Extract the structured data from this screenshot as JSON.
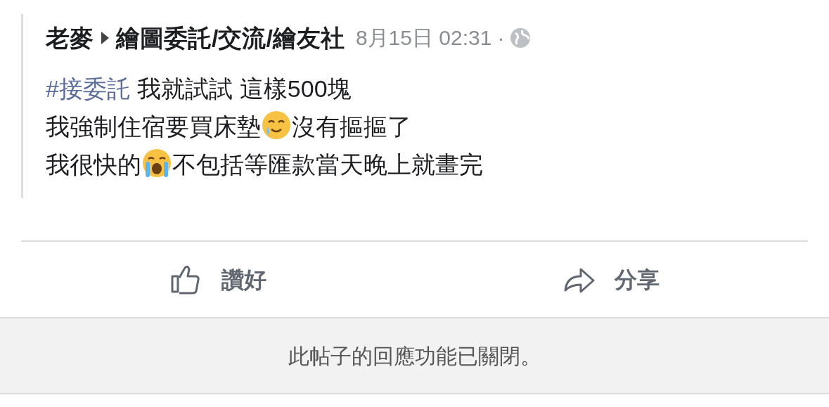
{
  "post": {
    "author": "老麥",
    "group": "繪圖委託/交流/繪友社",
    "time": "8月15日 02:31",
    "separator": "·",
    "lines": [
      [
        {
          "kind": "hashtag",
          "text": "#接委託"
        },
        {
          "kind": "text",
          "text": " 我就試試 這樣500塊"
        }
      ],
      [
        {
          "kind": "text",
          "text": "我強制住宿要買床墊"
        },
        {
          "kind": "teary"
        },
        {
          "kind": "text",
          "text": "沒有摳摳了"
        }
      ],
      [
        {
          "kind": "text",
          "text": "我很快的"
        },
        {
          "kind": "sob"
        },
        {
          "kind": "text",
          "text": "不包括等匯款當天晚上就畫完"
        }
      ]
    ]
  },
  "actions": [
    {
      "kind": "like",
      "label": "讚好"
    },
    {
      "kind": "share",
      "label": "分享"
    }
  ],
  "notice": "此帖子的回應功能已關閉。"
}
